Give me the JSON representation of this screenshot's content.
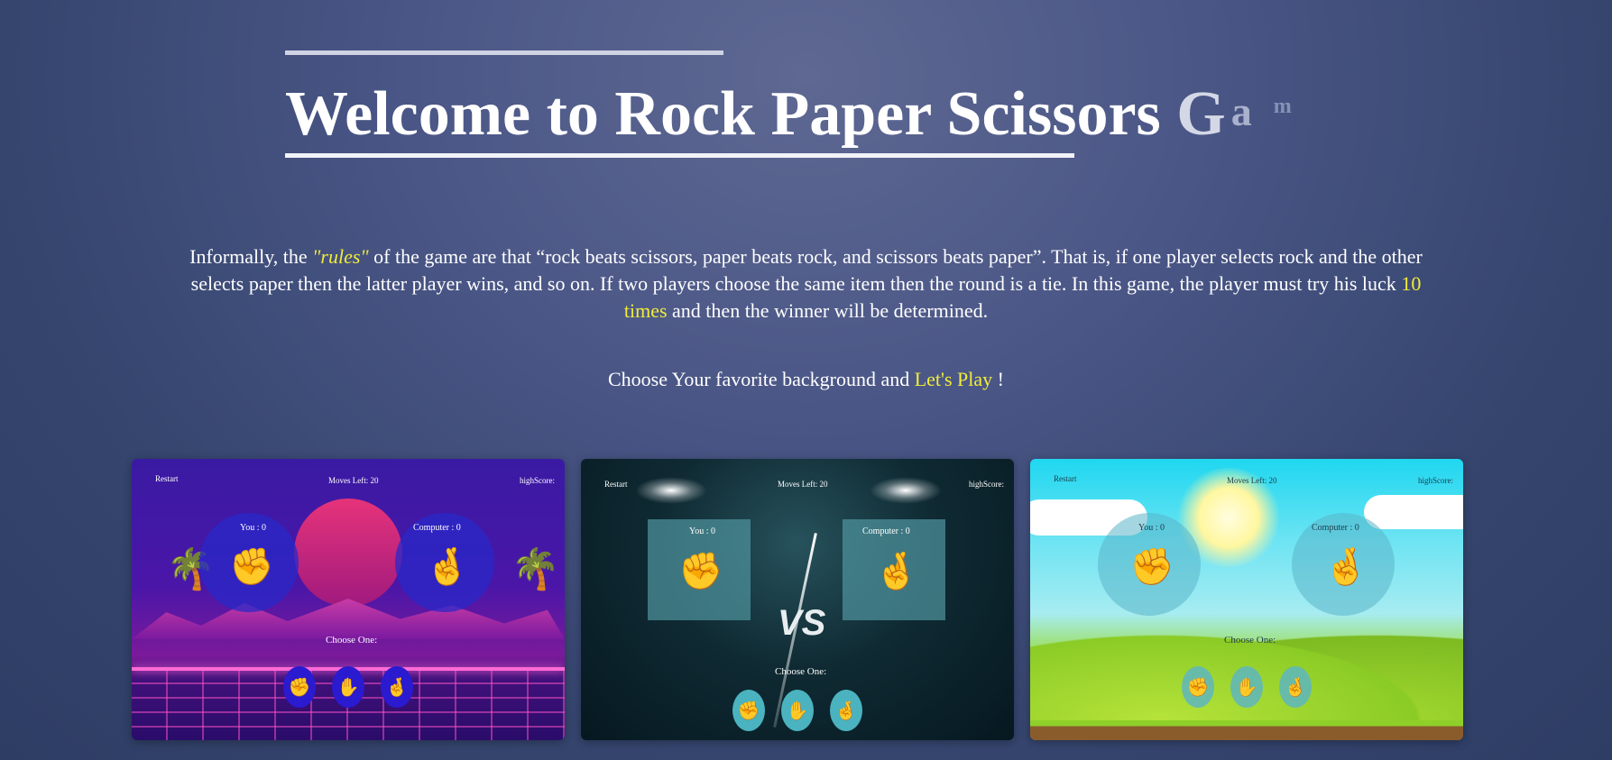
{
  "header": {
    "title_main": "Welcome to Rock Paper Scissors ",
    "title_g": "G",
    "title_a": "a",
    "title_m": "m"
  },
  "intro": {
    "part1": "Informally, the ",
    "rules": "\"rules\"",
    "part2": " of the game are that “rock beats scissors, paper beats rock, and scissors beats paper”. That is, if one player selects rock and the other selects paper then the latter player wins, and so on. If two players choose the same item then the round is a tie. In this game, the player must try his luck ",
    "times": "10 times",
    "part3": " and then the winner will be determined."
  },
  "choose": {
    "text": "Choose Your favorite background and ",
    "lets_play": "Let's Play",
    "end": " !"
  },
  "themes": [
    {
      "restart": "Restart",
      "moves": "Moves Left: 20",
      "highscore": "highScore:",
      "you": "You : 0",
      "computer": "Computer : 0",
      "choose_one": "Choose One:"
    },
    {
      "restart": "Restart",
      "moves": "Moves Left: 20",
      "highscore": "highScore:",
      "you": "You : 0",
      "computer": "Computer : 0",
      "choose_one": "Choose One:",
      "vs": "VS"
    },
    {
      "restart": "Restart",
      "moves": "Moves Left: 20",
      "highscore": "highScore:",
      "you": "You : 0",
      "computer": "Computer : 0",
      "choose_one": "Choose One:"
    }
  ],
  "icons": {
    "rock": "✊",
    "paper": "✋",
    "scissors": "🤞"
  },
  "colors": {
    "accent_yellow": "#f1ec3a",
    "hand_orange": "#f59a0a"
  }
}
